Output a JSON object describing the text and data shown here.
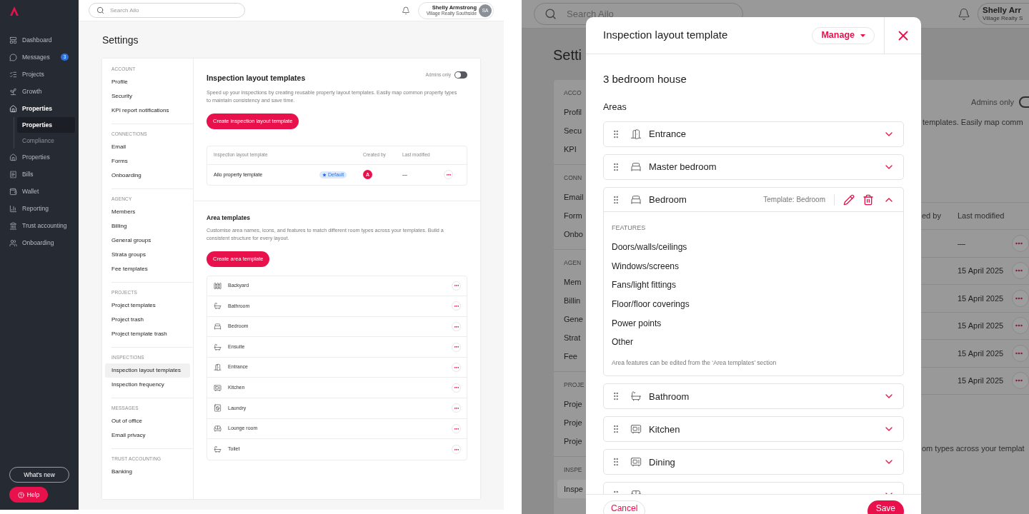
{
  "left_screen": {
    "sidebar": {
      "items": [
        {
          "label": "Dashboard",
          "kind": "dashboard",
          "selected": false
        },
        {
          "label": "Messages",
          "kind": "chat",
          "selected": false,
          "badge": "3"
        },
        {
          "label": "Projects",
          "kind": "list",
          "selected": false
        },
        {
          "label": "Growth",
          "kind": "plant",
          "selected": false
        },
        {
          "label": "Properties",
          "kind": "house",
          "selected": true,
          "children": [
            {
              "label": "Properties",
              "selected": true
            },
            {
              "label": "Compliance",
              "selected": false
            }
          ]
        },
        {
          "label": "Properties",
          "kind": "house",
          "selected": false
        },
        {
          "label": "Bills",
          "kind": "receipt",
          "selected": false
        },
        {
          "label": "Wallet",
          "kind": "wallet",
          "selected": false
        },
        {
          "label": "Reporting",
          "kind": "chart",
          "selected": false
        },
        {
          "label": "Trust accounting",
          "kind": "bank",
          "selected": false
        },
        {
          "label": "Onboarding",
          "kind": "people",
          "selected": false
        }
      ],
      "whats_new": "What's new",
      "help": "Help"
    },
    "header": {
      "search_placeholder": "Search Ailo",
      "user_name": "Shelly Armstrong",
      "user_agency": "Village Realty Southside",
      "user_initials": "SA"
    },
    "page_title": "Settings",
    "settings_nav": [
      {
        "heading": "ACCOUNT",
        "items": [
          {
            "label": "Profile",
            "selected": false
          },
          {
            "label": "Security",
            "selected": false
          },
          {
            "label": "KPI report notifications",
            "selected": false
          }
        ]
      },
      {
        "heading": "CONNECTIONS",
        "items": [
          {
            "label": "Email",
            "selected": false
          },
          {
            "label": "Forms",
            "selected": false
          },
          {
            "label": "Onboarding",
            "selected": false
          }
        ]
      },
      {
        "heading": "AGENCY",
        "items": [
          {
            "label": "Members",
            "selected": false
          },
          {
            "label": "Billing",
            "selected": false
          },
          {
            "label": "General groups",
            "selected": false
          },
          {
            "label": "Strata groups",
            "selected": false
          },
          {
            "label": "Fee templates",
            "selected": false
          }
        ]
      },
      {
        "heading": "PROJECTS",
        "items": [
          {
            "label": "Project templates",
            "selected": false
          },
          {
            "label": "Project trash",
            "selected": false
          },
          {
            "label": "Project template trash",
            "selected": false
          }
        ]
      },
      {
        "heading": "INSPECTIONS",
        "items": [
          {
            "label": "Inspection layout templates",
            "selected": true
          },
          {
            "label": "Inspection frequency",
            "selected": false
          }
        ]
      },
      {
        "heading": "MESSAGES",
        "items": [
          {
            "label": "Out of office",
            "selected": false
          },
          {
            "label": "Email privacy",
            "selected": false
          }
        ]
      },
      {
        "heading": "TRUST ACCOUNTING",
        "items": [
          {
            "label": "Banking",
            "selected": false
          }
        ]
      }
    ],
    "layout_templates": {
      "title": "Inspection layout templates",
      "admins_only_label": "Admins only",
      "admins_only_on": false,
      "description": "Speed up your inspections by creating reusable property layout templates. Easily map common property types to maintain consistency and save time.",
      "create_button": "Create inspection layout template",
      "columns": [
        "Inspection layout template",
        "Created by",
        "Last modified"
      ],
      "rows": [
        {
          "name": "Ailo property template",
          "badge": "Default",
          "created_by": "A",
          "last_modified": "—"
        }
      ]
    },
    "area_templates": {
      "title": "Area templates",
      "description": "Customise area names, icons, and features to match different room types across your templates. Build a consistent structure for every layout.",
      "create_button": "Create area template",
      "items": [
        {
          "name": "Backyard",
          "kind": "yard"
        },
        {
          "name": "Bathroom",
          "kind": "bath"
        },
        {
          "name": "Bedroom",
          "kind": "bed"
        },
        {
          "name": "Ensuite",
          "kind": "bath"
        },
        {
          "name": "Entrance",
          "kind": "door"
        },
        {
          "name": "Kitchen",
          "kind": "oven"
        },
        {
          "name": "Laundry",
          "kind": "washer"
        },
        {
          "name": "Lounge room",
          "kind": "sofa"
        },
        {
          "name": "Toilet",
          "kind": "bath"
        }
      ]
    }
  },
  "right_screen": {
    "background": {
      "search_placeholder": "Search Ailo",
      "user_name": "Shelly Arr",
      "user_agency": "Village Realty S",
      "page_title": "Setti",
      "nav": [
        {
          "heading": "ACCO",
          "items": [
            {
              "label": "Profil",
              "selected": false
            },
            {
              "label": "Secu",
              "selected": false
            },
            {
              "label": "KPI",
              "selected": false
            }
          ]
        },
        {
          "heading": "CONN",
          "items": [
            {
              "label": "Email",
              "selected": false
            },
            {
              "label": "Form",
              "selected": false
            },
            {
              "label": "Onbo",
              "selected": false
            }
          ]
        },
        {
          "heading": "AGEN",
          "items": [
            {
              "label": "Mem",
              "selected": false
            },
            {
              "label": "Billin",
              "selected": false
            },
            {
              "label": "Gene",
              "selected": false
            },
            {
              "label": "Strat",
              "selected": false
            },
            {
              "label": "Fee",
              "selected": false
            }
          ]
        },
        {
          "heading": "PROJE",
          "items": [
            {
              "label": "Proje",
              "selected": false
            },
            {
              "label": "Proje",
              "selected": false
            },
            {
              "label": "Proje",
              "selected": false
            }
          ]
        },
        {
          "heading": "INSPE",
          "items": [
            {
              "label": "Inspe",
              "selected": true
            }
          ]
        }
      ],
      "admins_only_label": "Admins only",
      "description": "templates. Easily map comm",
      "columns": [
        "ed by",
        "Last modified"
      ],
      "rows": [
        {
          "last_modified": "—"
        },
        {
          "last_modified": "15 April 2025"
        },
        {
          "last_modified": "15 April 2025"
        },
        {
          "last_modified": "15 April 2025"
        },
        {
          "last_modified": "15 April 2025"
        },
        {
          "last_modified": "15 April 2025"
        }
      ],
      "area_description": "om types across your templat"
    },
    "modal": {
      "title": "Inspection layout template",
      "manage_button": "Manage",
      "template_name": "3 bedroom house",
      "areas_heading": "Areas",
      "areas": [
        {
          "name": "Entrance",
          "kind": "door",
          "expanded": false
        },
        {
          "name": "Master bedroom",
          "kind": "bed",
          "expanded": false
        },
        {
          "name": "Bedroom",
          "kind": "bed",
          "expanded": true,
          "template_label": "Template: Bedroom",
          "features_heading": "FEATURES",
          "features": [
            "Doors/walls/ceilings",
            "Windows/screens",
            "Fans/light fittings",
            "Floor/floor coverings",
            "Power points",
            "Other"
          ],
          "note": "Area features can be edited from the ‘Area templates’ section"
        },
        {
          "name": "Bathroom",
          "kind": "bath",
          "expanded": false
        },
        {
          "name": "Kitchen",
          "kind": "oven",
          "expanded": false
        },
        {
          "name": "Dining",
          "kind": "oven",
          "expanded": false
        },
        {
          "kind": "sofa",
          "expanded": false
        }
      ],
      "cancel_button": "Cancel",
      "save_button": "Save"
    }
  }
}
